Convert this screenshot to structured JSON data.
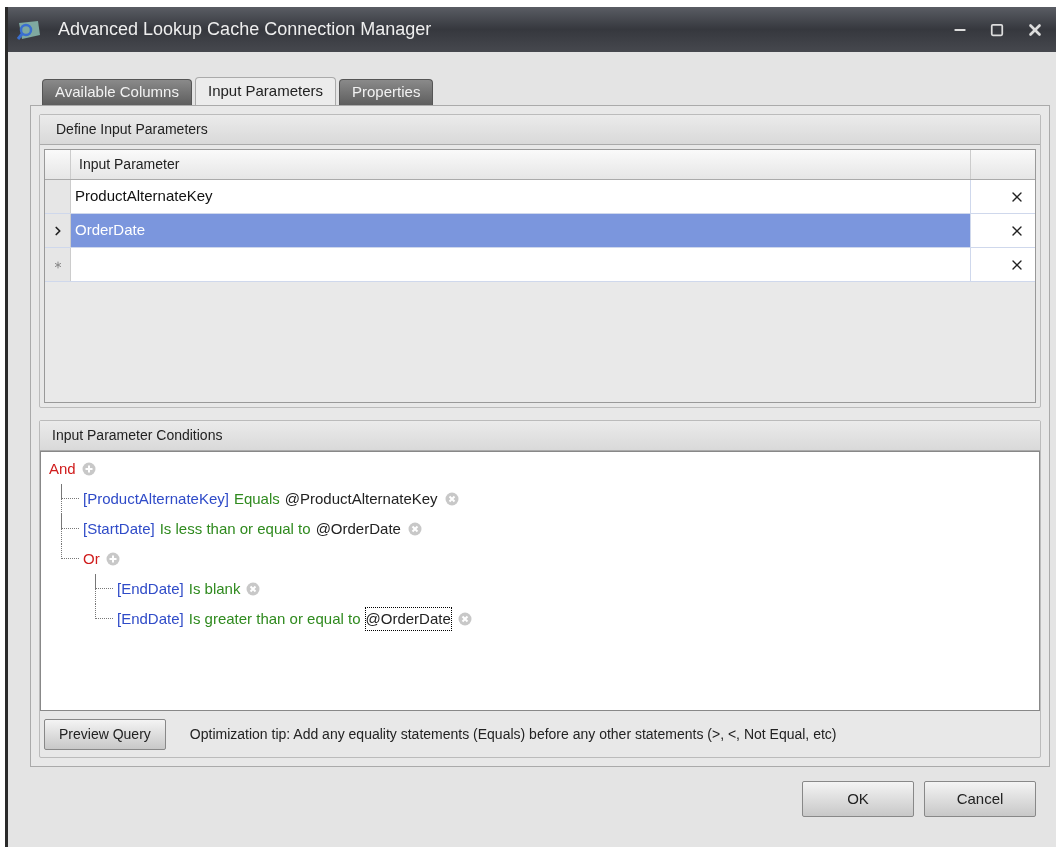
{
  "window": {
    "title": "Advanced Lookup Cache Connection Manager"
  },
  "tabs": [
    {
      "label": "Available Columns",
      "selected": false
    },
    {
      "label": "Input Parameters",
      "selected": true
    },
    {
      "label": "Properties",
      "selected": false
    }
  ],
  "parameters": {
    "title": "Define Input Parameters",
    "column": "Input Parameter",
    "rows": [
      {
        "kind": "plain",
        "value": "ProductAlternateKey",
        "selected": false
      },
      {
        "kind": "current",
        "value": "OrderDate",
        "selected": true
      },
      {
        "kind": "new",
        "selected": false
      }
    ]
  },
  "conditions": {
    "title": "Input Parameter Conditions",
    "tree": {
      "kind": "group",
      "operator": "And",
      "children": [
        {
          "kind": "condition",
          "field": "[ProductAlternateKey]",
          "operator": "Equals",
          "value": "@ProductAlternateKey",
          "focused": false
        },
        {
          "kind": "condition",
          "field": "[StartDate]",
          "operator": "Is less than or equal to",
          "value": "@OrderDate",
          "focused": false
        },
        {
          "kind": "group",
          "operator": "Or",
          "children": [
            {
              "kind": "condition",
              "field": "[EndDate]",
              "operator": "Is blank"
            },
            {
              "kind": "condition",
              "field": "[EndDate]",
              "operator": "Is greater than or equal to",
              "value": "@OrderDate",
              "focused": true
            }
          ]
        }
      ]
    }
  },
  "preview_button": "Preview Query",
  "tip": "Optimization tip: Add any equality statements (Equals) before any other statements (>, <, Not Equal, etc)",
  "buttons": [
    "OK",
    "Cancel"
  ]
}
